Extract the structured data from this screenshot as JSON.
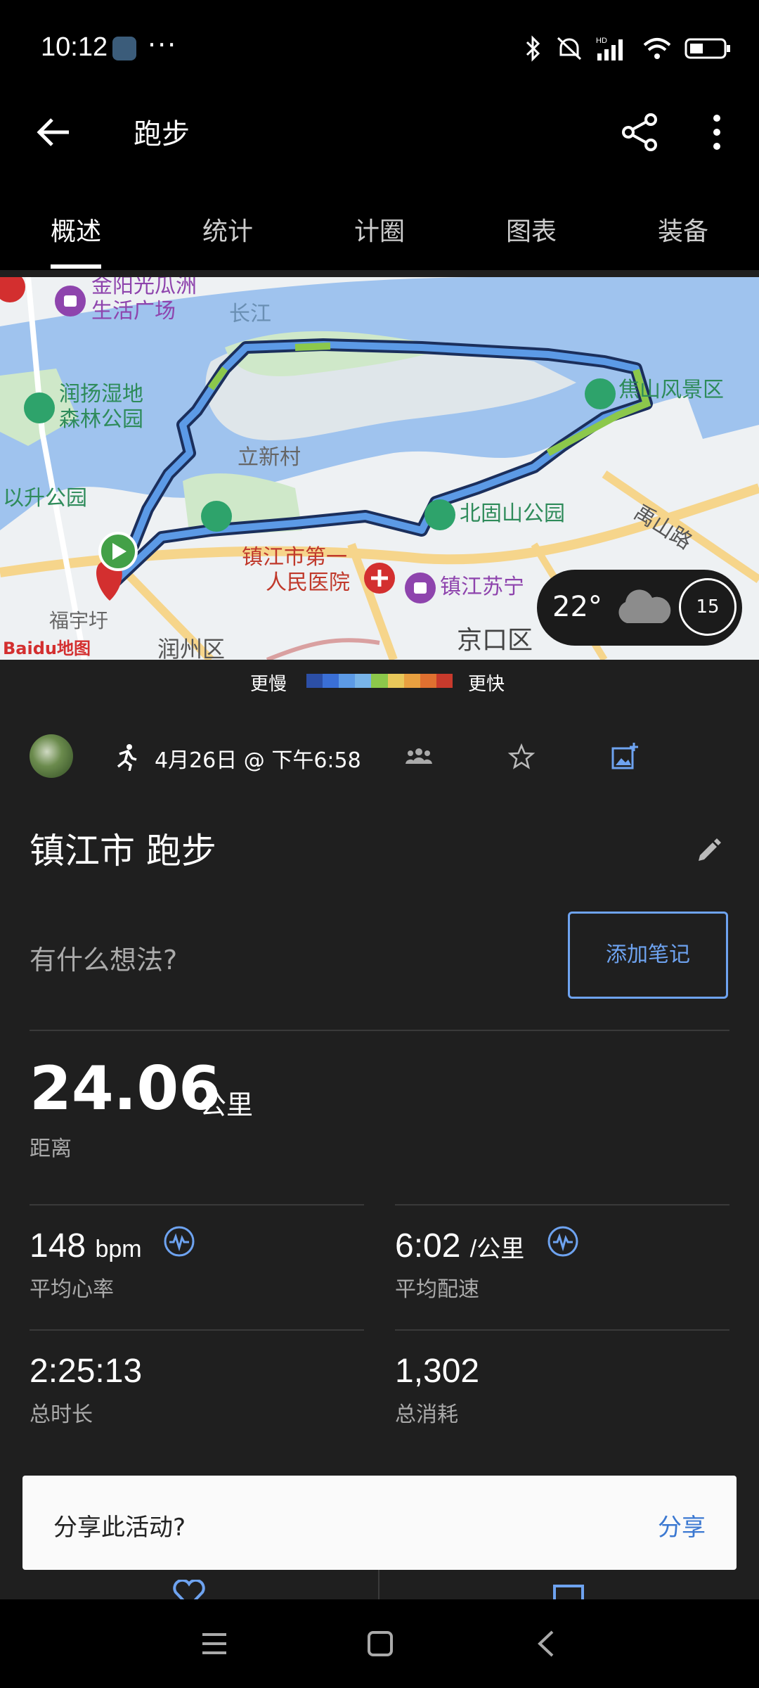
{
  "status_bar": {
    "time": "10:12",
    "more": "···",
    "network": "HD"
  },
  "app_bar": {
    "title": "跑步",
    "back_icon": "arrow-left-icon",
    "share_icon": "share-icon",
    "more_icon": "more-vert-icon"
  },
  "tabs": [
    {
      "label": "概述",
      "active": true
    },
    {
      "label": "统计",
      "active": false
    },
    {
      "label": "计圈",
      "active": false
    },
    {
      "label": "图表",
      "active": false
    },
    {
      "label": "装备",
      "active": false
    }
  ],
  "map": {
    "labels": {
      "jinyang": "金阳光瓜洲",
      "shenghuo": "生活广场",
      "changjiang": "长江",
      "runyang": "润扬湿地",
      "senlin": "森林公园",
      "lixincun": "立新村",
      "yisheng": "以升公园",
      "jiaoshan": "焦山风景区",
      "beigushan": "北固山公园",
      "yushan": "禹山路",
      "zhenjiang_first": "镇江市第一",
      "renmin": "人民医院",
      "zhenjiang_su": "镇江苏宁",
      "fuyu": "福宇圩",
      "runzhou": "润州区",
      "jingkou": "京口区",
      "baidu_logo": "Baidu地图"
    }
  },
  "weather": {
    "temperature": "22°",
    "wind": "15",
    "icon": "cloud-icon"
  },
  "legend": {
    "slow": "更慢",
    "fast": "更快",
    "colors": [
      "#2c4fa6",
      "#3a6fd6",
      "#5c9ae6",
      "#78b4e8",
      "#8cc84b",
      "#e8c85a",
      "#e8a040",
      "#e07030",
      "#c83a2c"
    ]
  },
  "activity": {
    "date": "4月26日 @ 下午6:58",
    "name": "镇江市 跑步",
    "thoughts_placeholder": "有什么想法?",
    "add_note": "添加笔记"
  },
  "distance": {
    "value": "24.06",
    "unit": "公里",
    "label": "距离"
  },
  "stats": {
    "heart_rate": {
      "value": "148",
      "unit": "bpm",
      "label": "平均心率"
    },
    "pace": {
      "value": "6:02",
      "unit": "/公里",
      "label": "平均配速"
    },
    "duration": {
      "value": "2:25:13",
      "label": "总时长"
    },
    "calories": {
      "value": "1,302",
      "label": "总消耗"
    }
  },
  "share": {
    "prompt": "分享此活动?",
    "action": "分享"
  },
  "accent": "#6ea3f0"
}
